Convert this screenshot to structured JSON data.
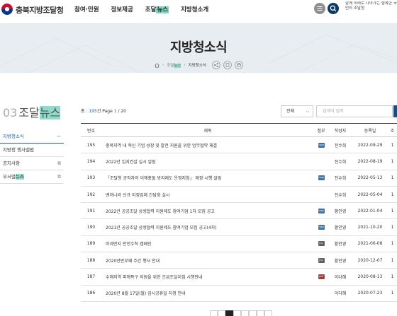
{
  "header": {
    "logo_text": "충북지방조달청",
    "nav": [
      {
        "label": "참여·민원",
        "hl": ""
      },
      {
        "label": "정보제공",
        "hl": ""
      },
      {
        "label": "조달",
        "hl": "뉴스"
      },
      {
        "label": "지방청소개",
        "hl": ""
      }
    ],
    "slogan": "함께 미래로 나아가는 행복한 국민의 조달청"
  },
  "hero": {
    "title": "지방청소식",
    "breadcrumb": [
      "조달",
      "뉴스",
      "지방청소식"
    ]
  },
  "side": {
    "num": "03",
    "title_a": "조달",
    "title_b": "뉴스",
    "items": [
      {
        "label": "지방청소식",
        "mark": "−",
        "active": true
      },
      {
        "label": "지방청 행사앨범",
        "mark": "",
        "active": false
      },
      {
        "label": "공지사항",
        "mark": "⧉",
        "active": false
      },
      {
        "label": "부서별",
        "label_hl": "뉴스",
        "mark": "⧉",
        "active": false
      }
    ]
  },
  "list": {
    "count_prefix": "총 : ",
    "count": "195",
    "count_mid": "건 Page ",
    "page": "1",
    "pages": "/ 20",
    "filter": "전체",
    "search_placeholder": "검색어 입력",
    "columns": [
      "번호",
      "제목",
      "첨부",
      "작성자",
      "등록일",
      "조"
    ],
    "rows": [
      {
        "no": "195",
        "title": "충북지역 내 혁신 기업 성장 및 발전 지원을 위한 업무협약 체결",
        "file": "hwp",
        "author": "전수희",
        "date": "2022-09-29",
        "v": "1"
      },
      {
        "no": "194",
        "title": "2022년 입지컨설 실시 알림",
        "file": "",
        "author": "전수희",
        "date": "2022-08-19",
        "v": "1"
      },
      {
        "no": "193",
        "title": "「조달청 공직자의 이해충돌 방지제도 운영지침」 제정·시행 알림",
        "file": "hwp",
        "author": "전수희",
        "date": "2022-05-13",
        "v": "1"
      },
      {
        "no": "192",
        "title": "벤처나라 신규 지정업체 간담회 실시",
        "file": "",
        "author": "전수희",
        "date": "2022-05-04",
        "v": "1"
      },
      {
        "no": "191",
        "title": "2022년 공공조달 상생협력 지원제도 참여기업 1차 모집 공고",
        "file": "hwp",
        "author": "황인영",
        "date": "2022-01-04",
        "v": "1"
      },
      {
        "no": "190",
        "title": "2021년 공공조달 상생협력 지원제도 참여기업 모집 공고(4차)",
        "file": "hwp",
        "author": "황인영",
        "date": "2021-10-20",
        "v": "1"
      },
      {
        "no": "189",
        "title": "미세먼지 안전수칙 캠페인",
        "file": "jpg",
        "author": "황인영",
        "date": "2021-06-08",
        "v": "1"
      },
      {
        "no": "188",
        "title": "2020년반부패 주간 행사 안내",
        "file": "jpg",
        "author": "황인영",
        "date": "2020-12-07",
        "v": "1"
      },
      {
        "no": "187",
        "title": "수해지역 피해복구 지원을 위한 긴급조달지침 시행안내",
        "file": "pdf",
        "author": "이다혜",
        "date": "2020-08-13",
        "v": "1"
      },
      {
        "no": "186",
        "title": "2020년 8월 17일(월) 임시공휴일 지정 안내",
        "file": "",
        "author": "이다혜",
        "date": "2020-07-23",
        "v": "1"
      }
    ]
  },
  "colors": {
    "accent_hl": "#8fdacb",
    "navy": "#0d3a63",
    "link_blue": "#1b66c9"
  }
}
